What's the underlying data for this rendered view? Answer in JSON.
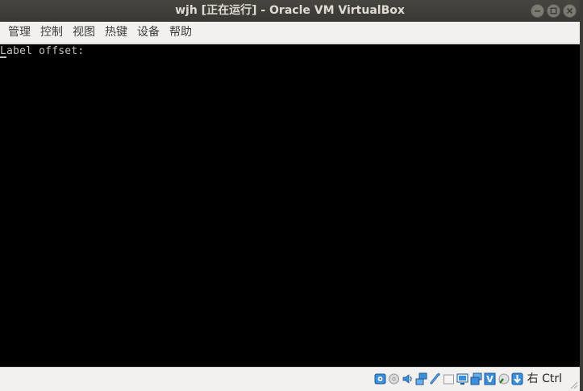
{
  "window": {
    "title": "wjh [正在运行] - Oracle VM VirtualBox"
  },
  "menu": [
    {
      "label": "管理"
    },
    {
      "label": "控制"
    },
    {
      "label": "视图"
    },
    {
      "label": "热键"
    },
    {
      "label": "设备"
    },
    {
      "label": "帮助"
    }
  ],
  "screen": {
    "console_line": "Label offset:"
  },
  "statusbar": {
    "icons": [
      "hard-disk-icon",
      "optical-drive-icon",
      "audio-icon",
      "network-icon",
      "usb-icon",
      "shared-folders-icon",
      "display-icon",
      "video-capture-icon",
      "virtualization-icon",
      "mouse-integration-icon",
      "keyboard-capture-icon"
    ],
    "host_key": "右 Ctrl"
  },
  "colors": {
    "titlebar": "#3f3e39",
    "title_text": "#dfdbd2",
    "screen": "#000000",
    "console_text": "#c0c0c0",
    "chrome": "#f2f1f0"
  }
}
